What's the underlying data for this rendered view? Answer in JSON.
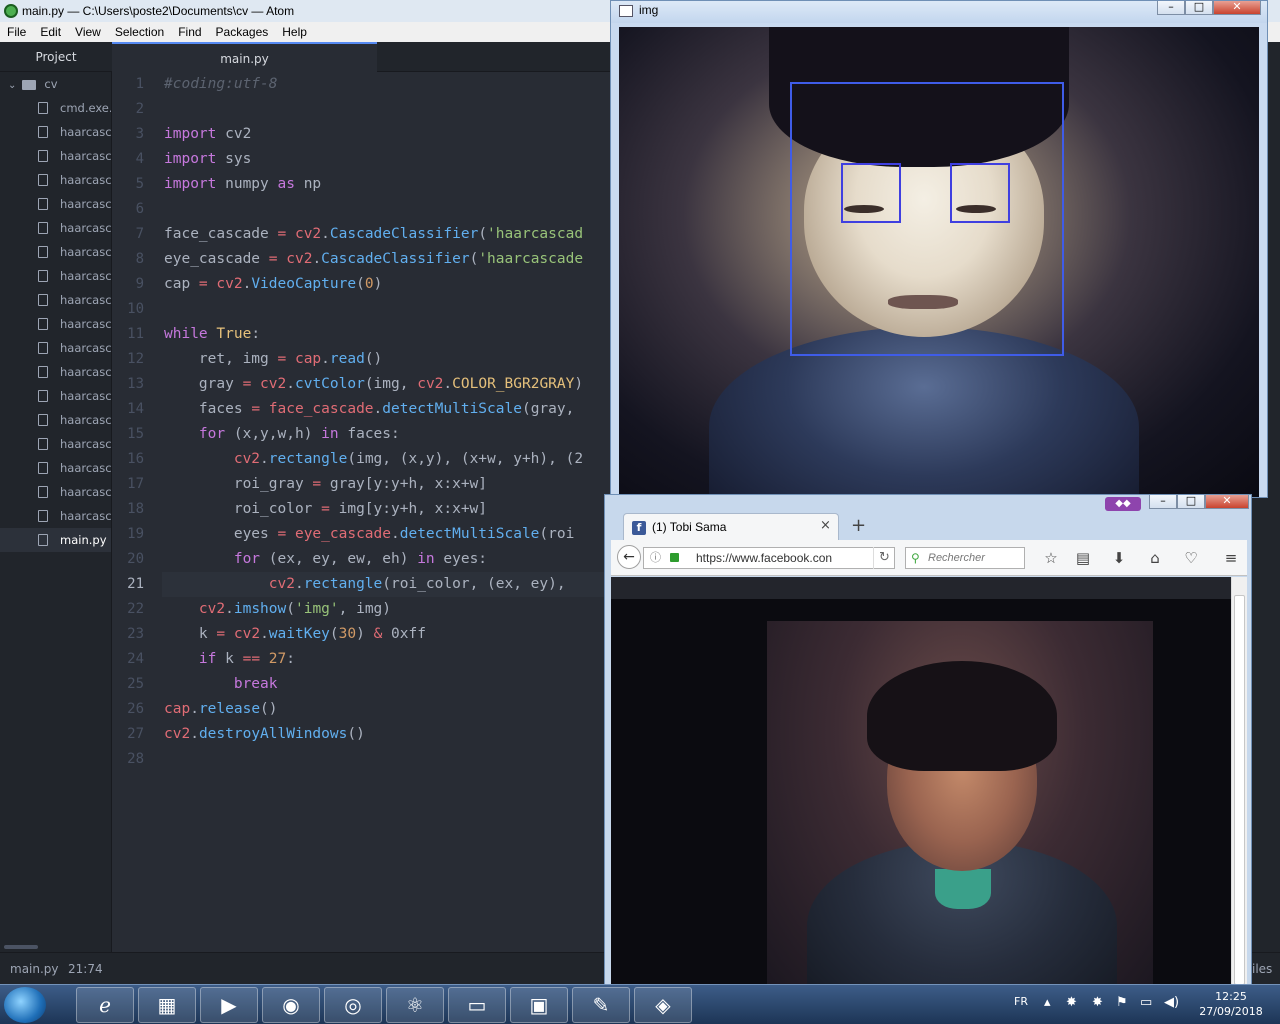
{
  "atom": {
    "window_title": "main.py — C:\\Users\\poste2\\Documents\\cv — Atom",
    "menu": [
      "File",
      "Edit",
      "View",
      "Selection",
      "Find",
      "Packages",
      "Help"
    ],
    "tree_header": "Project",
    "root_folder": "cv",
    "files": [
      "cmd.exe.lnk",
      "haarcascade",
      "haarcascade",
      "haarcascade",
      "haarcascade",
      "haarcascade",
      "haarcascade",
      "haarcascade",
      "haarcascade",
      "haarcascade",
      "haarcascade",
      "haarcascade",
      "haarcascade",
      "haarcascade",
      "haarcascade",
      "haarcascade",
      "haarcascade",
      "haarcascade"
    ],
    "selected_file": "main.py",
    "tab": "main.py",
    "line_numbers": [
      "1",
      "2",
      "3",
      "4",
      "5",
      "6",
      "7",
      "8",
      "9",
      "10",
      "11",
      "12",
      "13",
      "14",
      "15",
      "16",
      "17",
      "18",
      "19",
      "20",
      "21",
      "22",
      "23",
      "24",
      "25",
      "26",
      "27",
      "28"
    ],
    "current_line": "21",
    "code": [
      "#coding:utf-8",
      "",
      "import cv2",
      "import sys",
      "import numpy as np",
      "",
      "face_cascade = cv2.CascadeClassifier('haarcascad",
      "eye_cascade = cv2.CascadeClassifier('haarcascade",
      "cap = cv2.VideoCapture(0)",
      "",
      "while True:",
      "    ret, img = cap.read()",
      "    gray = cv2.cvtColor(img, cv2.COLOR_BGR2GRAY)",
      "    faces = face_cascade.detectMultiScale(gray, ",
      "    for (x,y,w,h) in faces:",
      "        cv2.rectangle(img, (x,y), (x+w, y+h), (2",
      "        roi_gray = gray[y:y+h, x:x+w]",
      "        roi_color = img[y:y+h, x:x+w]",
      "        eyes = eye_cascade.detectMultiScale(roi",
      "        for (ex, ey, ew, eh) in eyes:",
      "            cv2.rectangle(roi_color, (ex, ey), ",
      "    cv2.imshow('img', img)",
      "    k = cv2.waitKey(30) & 0xff",
      "    if k == 27:",
      "        break",
      "cap.release()",
      "cv2.destroyAllWindows()",
      ""
    ],
    "status_file": "main.py",
    "status_cursor": "21:74",
    "status_right": "iles"
  },
  "img_window": {
    "title": "img",
    "buttons": [
      "–",
      "□",
      "✕"
    ]
  },
  "firefox": {
    "tab_title": "(1) Tobi Sama",
    "tab_close": "×",
    "new_tab": "+",
    "url": "https://www.facebook.con",
    "search_placeholder": "Rechercher",
    "favicon": "f",
    "window_buttons": [
      "–",
      "□",
      "✕"
    ]
  },
  "taskbar": {
    "apps": [
      "internet-explorer",
      "file-explorer",
      "media-player",
      "firefox",
      "chrome",
      "atom",
      "cmd",
      "task-manager",
      "paint",
      "python"
    ],
    "language": "FR",
    "time": "12:25",
    "date": "27/09/2018"
  },
  "colors": {
    "face_rect": "#3f5ce8",
    "eye_rect": "#3f3fe0",
    "atom_accent": "#568af2"
  }
}
